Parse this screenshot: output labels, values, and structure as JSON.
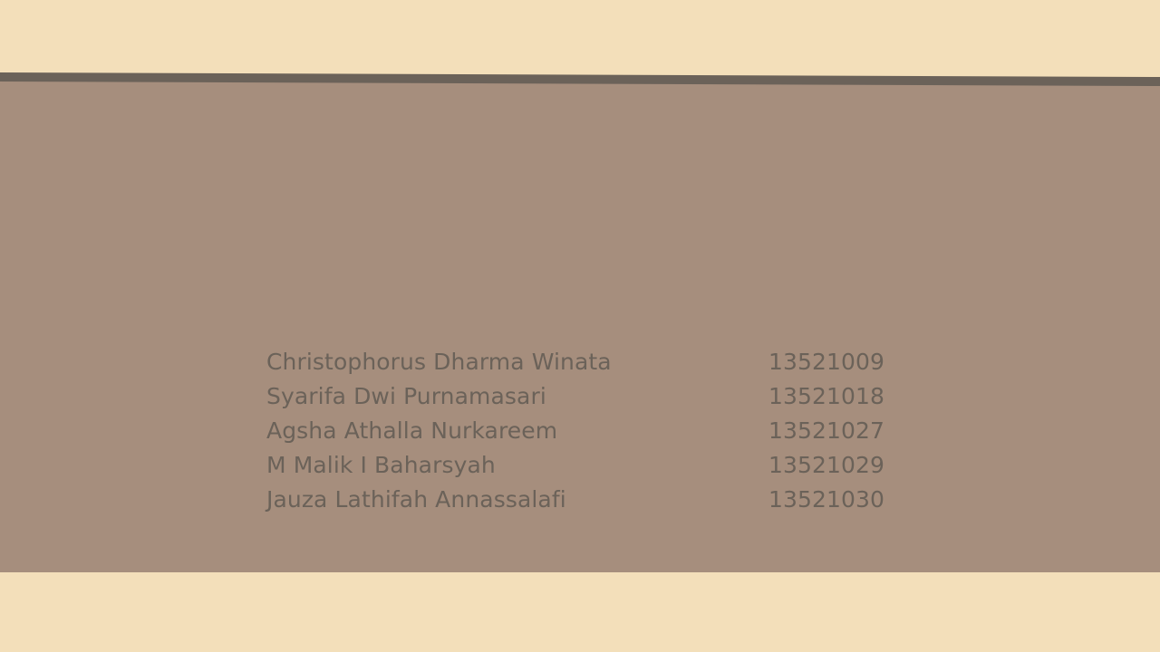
{
  "colors": {
    "background": "#f3dfba",
    "panel": "#a68e7d",
    "band": "#6b6259",
    "text": "#6b6259"
  },
  "members": [
    {
      "name": "Christophorus Dharma Winata",
      "id": "13521009"
    },
    {
      "name": "Syarifa Dwi Purnamasari",
      "id": "13521018"
    },
    {
      "name": "Agsha Athalla Nurkareem",
      "id": "13521027"
    },
    {
      "name": "M Malik I Baharsyah",
      "id": "13521029"
    },
    {
      "name": "Jauza Lathifah Annassalafi",
      "id": "13521030"
    }
  ]
}
